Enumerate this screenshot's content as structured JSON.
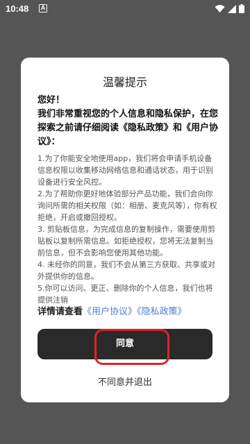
{
  "status_bar": {
    "time": "10:48",
    "notification_icon": "a-box-icon",
    "icons": [
      "wifi-icon",
      "signal-icon",
      "battery-icon"
    ]
  },
  "dialog": {
    "title": "温馨提示",
    "greeting": "您好！",
    "intro": "我们非常重视您的个人信息和隐私保护，在您探索之前请仔细阅读《隐私政策》和《用户协议》：",
    "items": [
      "1.为了你能安全地使用app，我们将会申请手机设备信息权限以收集移动网络信息和通话状态，用于识别设备进行安全风控。",
      "2.为了帮助你更好地体验部分产品功能，我们会向你询问所需的相关权限（如：相册、麦克风等），你有权拒绝，开启或撤回授权。",
      "3. 剪贴板信息，为完成信息的复制操作，需要使用剪贴板以复制所需信息。如拒绝授权，您将无法复制当前信息，但不会影响您使用其他功能。",
      "4. 未经你的同意，我们不会从第三方获取、共享或对外提供你的信息。",
      "5.你可以访问、更正、删除你的个人信息，我们也将提供注销"
    ],
    "details_prefix": "详情请查看",
    "user_agreement_link": "《用户协议》",
    "privacy_policy_link": "《隐私政策》",
    "agree_label": "同意",
    "decline_label": "不同意并退出"
  },
  "colors": {
    "overlay": "#555555",
    "button": "#2a2a2a",
    "link": "#4a7fd1",
    "highlight": "#e0202a"
  }
}
